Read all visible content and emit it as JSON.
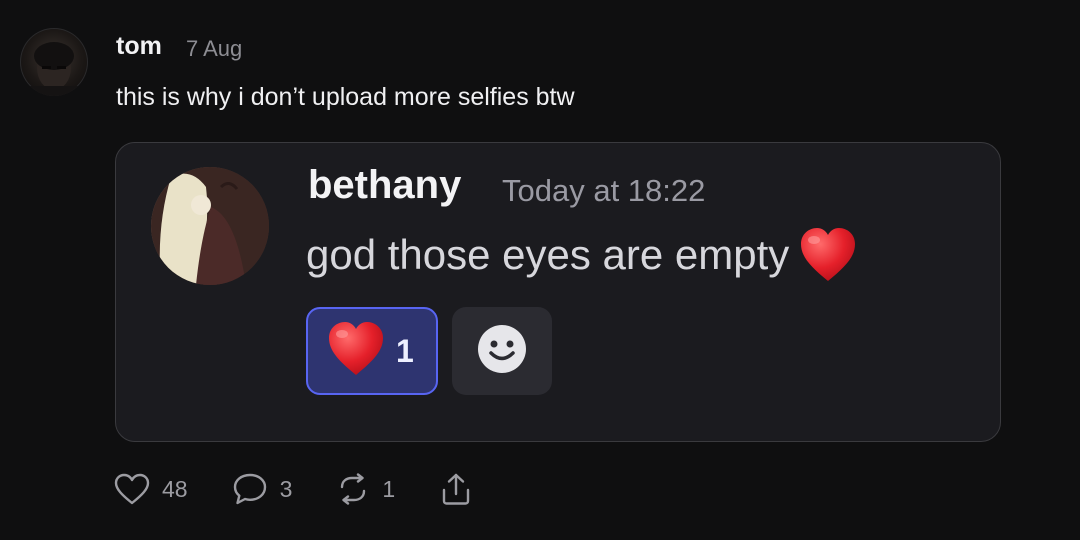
{
  "post": {
    "username": "tom",
    "date": "7 Aug",
    "text": "this is why i don’t upload more selfies btw"
  },
  "embed": {
    "username": "bethany",
    "time": "Today at 18:22",
    "message": "god those eyes are empty",
    "message_emoji_icon": "red-heart-icon",
    "reaction": {
      "icon": "red-heart-icon",
      "count": "1",
      "accent": "#5865f2"
    },
    "add_reaction_icon": "smiley-icon"
  },
  "actions": {
    "likes": "48",
    "replies": "3",
    "reposts": "1",
    "share_icon": "share-icon"
  }
}
